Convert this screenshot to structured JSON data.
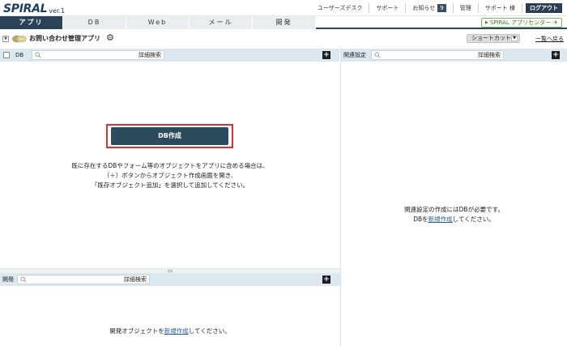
{
  "header": {
    "logo_text": "SPIRAL",
    "logo_version": "ver.1",
    "links": [
      {
        "label": "ユーザーズデスク"
      },
      {
        "label": "サポート"
      },
      {
        "label": "お知らせ",
        "badge": "9"
      },
      {
        "label": "管理"
      },
      {
        "label": "サポート 様"
      }
    ],
    "logout_label": "ログアウト"
  },
  "tabs": [
    {
      "label": "アプリ",
      "active": true
    },
    {
      "label": "DB",
      "active": false
    },
    {
      "label": "Web",
      "active": false
    },
    {
      "label": "メール",
      "active": false
    },
    {
      "label": "開発",
      "active": false
    }
  ],
  "app_center_label": "SPIRAL アプリセンター",
  "app": {
    "name": "お問い合わせ管理アプリ",
    "shortcut_label": "ショートカット",
    "back_link": "一覧へ戻る"
  },
  "db_panel": {
    "label": "DB",
    "search_advanced": "詳細検索",
    "create_button": "DB作成",
    "message_lines": [
      "既に存在するDBやフォーム等のオブジェクトをアプリに含める場合は、",
      "（＋）ボタンからオブジェクト作成画面を開き、",
      "「既存オブジェクト追加」を選択して追加してください。"
    ]
  },
  "related_panel": {
    "label": "関連設定",
    "search_advanced": "詳細検索",
    "message_line1": "関連設定の作成にはDBが必要です。",
    "message_prefix": "DBを",
    "message_link": "新規作成",
    "message_suffix": "してください。"
  },
  "dev_panel": {
    "label": "開発",
    "search_advanced": "詳細検索",
    "message_prefix": "開発オブジェクトを",
    "message_link": "新規作成",
    "message_suffix": "してください。"
  },
  "colors": {
    "nav_dark": "#2b4357",
    "panel_bar": "#dce8ef",
    "highlight": "#e03030",
    "button": "#2e4a5e"
  }
}
